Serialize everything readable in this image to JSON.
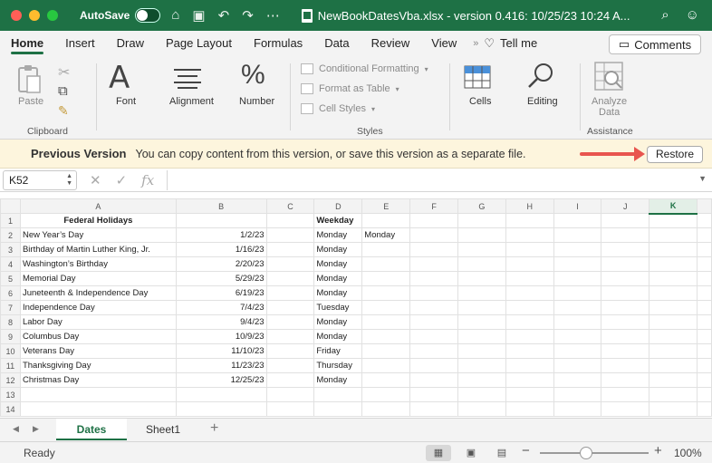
{
  "titlebar": {
    "autosave_label": "AutoSave",
    "title": "NewBookDatesVba.xlsx  -  version 0.416: 10/25/23 10:24 A..."
  },
  "ribbon_tabs": [
    "Home",
    "Insert",
    "Draw",
    "Page Layout",
    "Formulas",
    "Data",
    "Review",
    "View",
    "Tell me"
  ],
  "comments_label": "Comments",
  "ribbon": {
    "clipboard": {
      "paste": "Paste",
      "group": "Clipboard"
    },
    "font": "Font",
    "alignment": "Alignment",
    "number": "Number",
    "styles": {
      "conditional": "Conditional Formatting",
      "table": "Format as Table",
      "cell_styles": "Cell Styles",
      "group": "Styles"
    },
    "cells": "Cells",
    "editing": "Editing",
    "analyze": {
      "line1": "Analyze",
      "line2": "Data",
      "group": "Assistance"
    }
  },
  "infobar": {
    "title": "Previous Version",
    "message": "You can copy content from this version, or save this version as a separate file.",
    "restore": "Restore"
  },
  "formula_bar": {
    "namebox": "K52",
    "fx": "fx"
  },
  "columns": [
    "A",
    "B",
    "C",
    "D",
    "E",
    "F",
    "G",
    "H",
    "I",
    "J",
    "K"
  ],
  "selected_column": "K",
  "rows": [
    {
      "n": "1",
      "a": "Federal Holidays",
      "b": "",
      "d": "Weekday",
      "e": ""
    },
    {
      "n": "2",
      "a": "New Year’s Day",
      "b": "1/2/23",
      "d": "Monday",
      "e": "Monday"
    },
    {
      "n": "3",
      "a": "Birthday of Martin Luther King, Jr.",
      "b": "1/16/23",
      "d": "Monday",
      "e": ""
    },
    {
      "n": "4",
      "a": "Washington’s Birthday",
      "b": "2/20/23",
      "d": "Monday",
      "e": ""
    },
    {
      "n": "5",
      "a": "Memorial Day",
      "b": "5/29/23",
      "d": "Monday",
      "e": ""
    },
    {
      "n": "6",
      "a": "Juneteenth & Independence Day",
      "b": "6/19/23",
      "d": "Monday",
      "e": ""
    },
    {
      "n": "7",
      "a": "Independence Day",
      "b": "7/4/23",
      "d": "Tuesday",
      "e": ""
    },
    {
      "n": "8",
      "a": "Labor Day",
      "b": "9/4/23",
      "d": "Monday",
      "e": ""
    },
    {
      "n": "9",
      "a": "Columbus Day",
      "b": "10/9/23",
      "d": "Monday",
      "e": ""
    },
    {
      "n": "10",
      "a": "Veterans Day",
      "b": "11/10/23",
      "d": "Friday",
      "e": ""
    },
    {
      "n": "11",
      "a": "Thanksgiving Day",
      "b": "11/23/23",
      "d": "Thursday",
      "e": ""
    },
    {
      "n": "12",
      "a": "Christmas Day",
      "b": "12/25/23",
      "d": "Monday",
      "e": ""
    },
    {
      "n": "13",
      "a": "",
      "b": "",
      "d": "",
      "e": ""
    },
    {
      "n": "14",
      "a": "",
      "b": "",
      "d": "",
      "e": ""
    }
  ],
  "sheet_tabs": [
    "Dates",
    "Sheet1"
  ],
  "status": {
    "ready": "Ready",
    "zoom": "100%"
  }
}
